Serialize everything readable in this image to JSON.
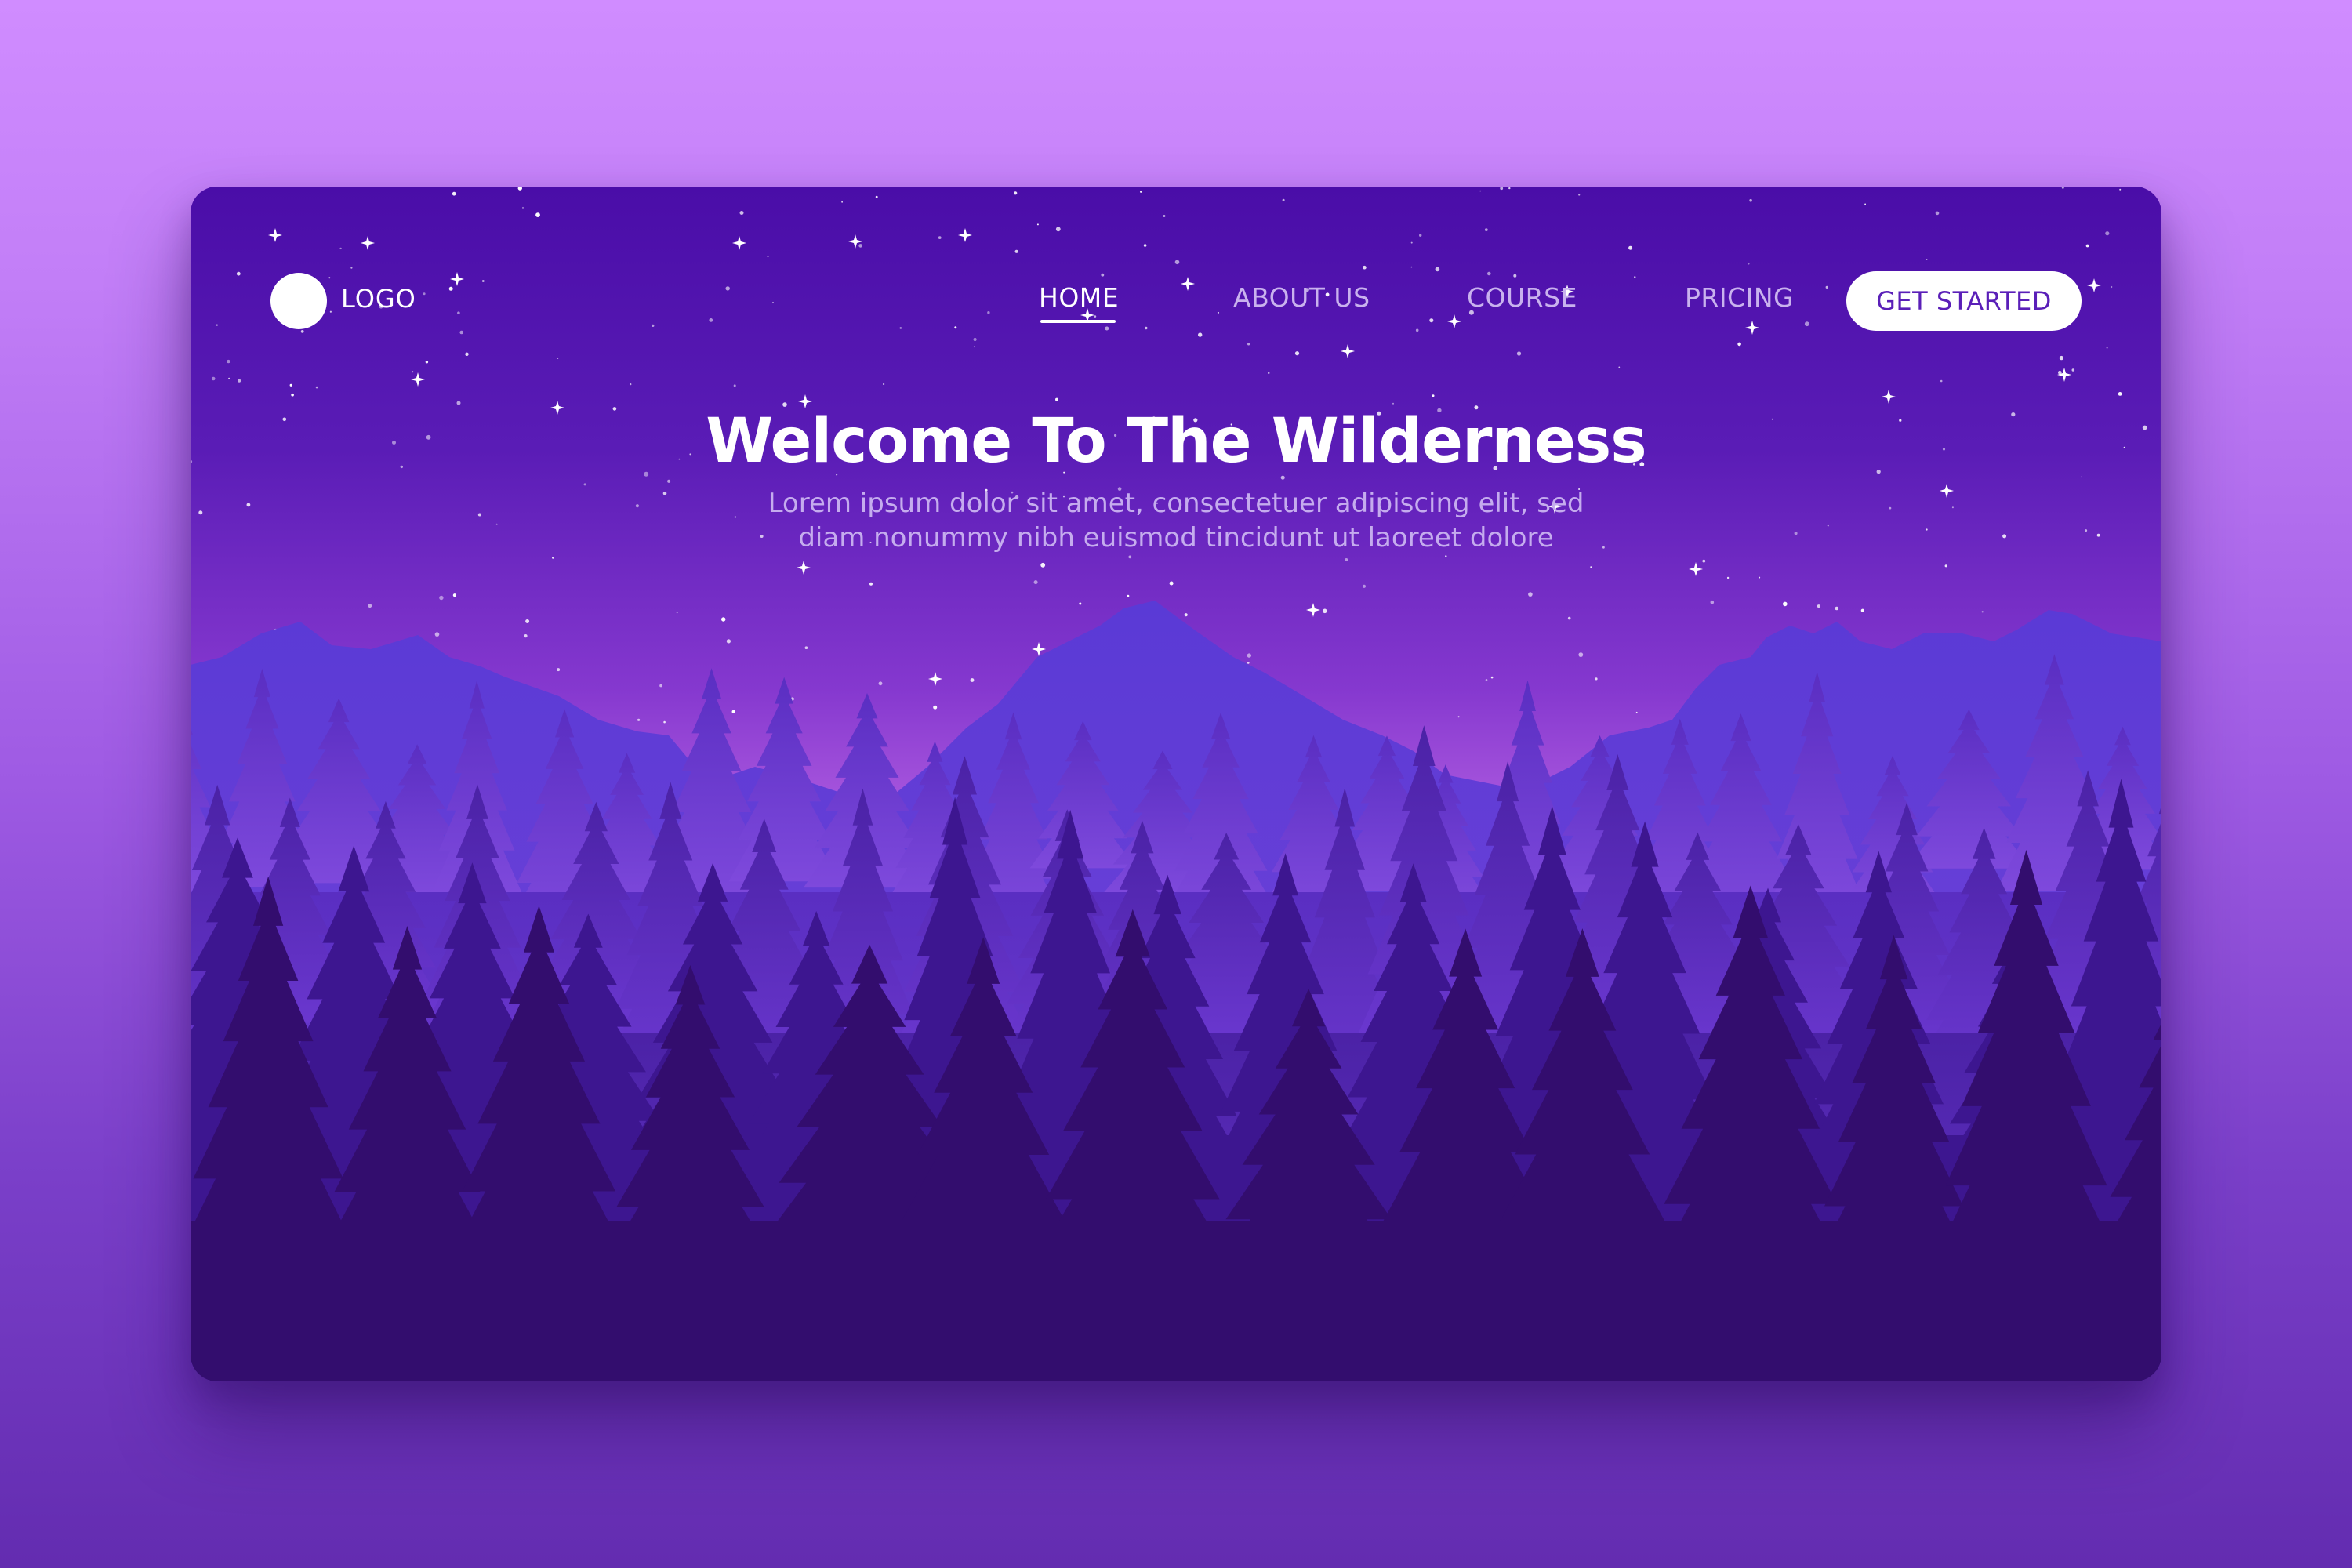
{
  "nav": {
    "logo_label": "LOGO",
    "items": [
      {
        "label": "HOME",
        "active": true
      },
      {
        "label": "ABOUT US",
        "active": false
      },
      {
        "label": "COURSE",
        "active": false
      },
      {
        "label": "PRICING",
        "active": false
      }
    ],
    "cta_label": "GET STARTED"
  },
  "hero": {
    "title": "Welcome To The Wilderness",
    "subtitle_line1": "Lorem ipsum dolor sit amet, consectetuer adipiscing elit, sed",
    "subtitle_line2": "diam nonummy nibh euismod tincidunt ut laoreet dolore"
  },
  "colors": {
    "page_background_top": "#d08cff",
    "page_background_bottom": "#632cb0",
    "sky_top": "#4a0da8",
    "sky_horizon": "#c06be7",
    "mountains": "#6c3bd6",
    "forest_far": "#5b2bc0",
    "forest_mid": "#4a20a2",
    "forest_near": "#330d6e",
    "cta_text": "#5a1fb8"
  },
  "icons": [
    "logo-circle-icon",
    "star-icon"
  ]
}
